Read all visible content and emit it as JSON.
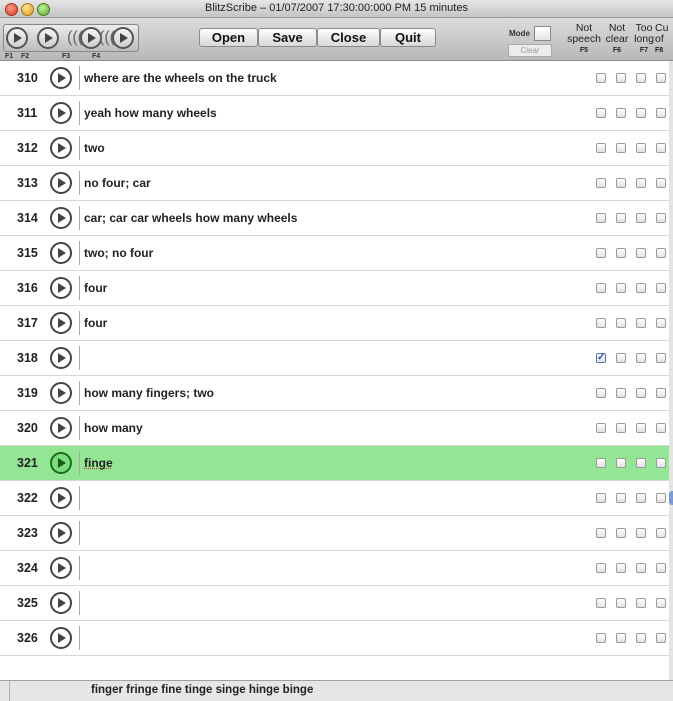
{
  "window": {
    "title": "BlitzScribe – 01/07/2007 17:30:00:000 PM 15 minutes"
  },
  "toolbar": {
    "fkeys": [
      "F1",
      "F2",
      "F3",
      "F4"
    ],
    "open_label": "Open",
    "save_label": "Save",
    "close_label": "Close",
    "quit_label": "Quit",
    "mode_label": "Mode",
    "clear_label": "Clear"
  },
  "columns": [
    {
      "top": "Not",
      "bottom": "speech",
      "key": "F5"
    },
    {
      "top": "Not",
      "bottom": "clear",
      "key": "F6"
    },
    {
      "top": "Too",
      "bottom": "long",
      "key": "F7"
    },
    {
      "top": "Cu",
      "bottom": "of",
      "key": "F8"
    }
  ],
  "rows": [
    {
      "num": "310",
      "text": "where are the wheels on the truck",
      "checks": [
        false,
        false,
        false,
        false
      ]
    },
    {
      "num": "311",
      "text": "yeah how many wheels",
      "checks": [
        false,
        false,
        false,
        false
      ]
    },
    {
      "num": "312",
      "text": "two",
      "checks": [
        false,
        false,
        false,
        false
      ]
    },
    {
      "num": "313",
      "text": "no four; car",
      "checks": [
        false,
        false,
        false,
        false
      ]
    },
    {
      "num": "314",
      "text": "car; car car wheels how many wheels",
      "checks": [
        false,
        false,
        false,
        false
      ]
    },
    {
      "num": "315",
      "text": "two; no four",
      "checks": [
        false,
        false,
        false,
        false
      ]
    },
    {
      "num": "316",
      "text": "four",
      "checks": [
        false,
        false,
        false,
        false
      ]
    },
    {
      "num": "317",
      "text": "four",
      "checks": [
        false,
        false,
        false,
        false
      ]
    },
    {
      "num": "318",
      "text": "",
      "checks": [
        true,
        false,
        false,
        false
      ]
    },
    {
      "num": "319",
      "text": "how many fingers; two",
      "checks": [
        false,
        false,
        false,
        false
      ]
    },
    {
      "num": "320",
      "text": "how many",
      "checks": [
        false,
        false,
        false,
        false
      ]
    },
    {
      "num": "321",
      "text": "finge",
      "checks": [
        false,
        false,
        false,
        false
      ],
      "selected": true
    },
    {
      "num": "322",
      "text": "",
      "checks": [
        false,
        false,
        false,
        false
      ]
    },
    {
      "num": "323",
      "text": "",
      "checks": [
        false,
        false,
        false,
        false
      ]
    },
    {
      "num": "324",
      "text": "",
      "checks": [
        false,
        false,
        false,
        false
      ]
    },
    {
      "num": "325",
      "text": "",
      "checks": [
        false,
        false,
        false,
        false
      ]
    },
    {
      "num": "326",
      "text": "",
      "checks": [
        false,
        false,
        false,
        false
      ]
    }
  ],
  "status": {
    "suggestions": "finger fringe fine tinge singe hinge binge"
  },
  "colors": {
    "selected_row": "#94e594",
    "checkmark": "#2b4fb8"
  }
}
